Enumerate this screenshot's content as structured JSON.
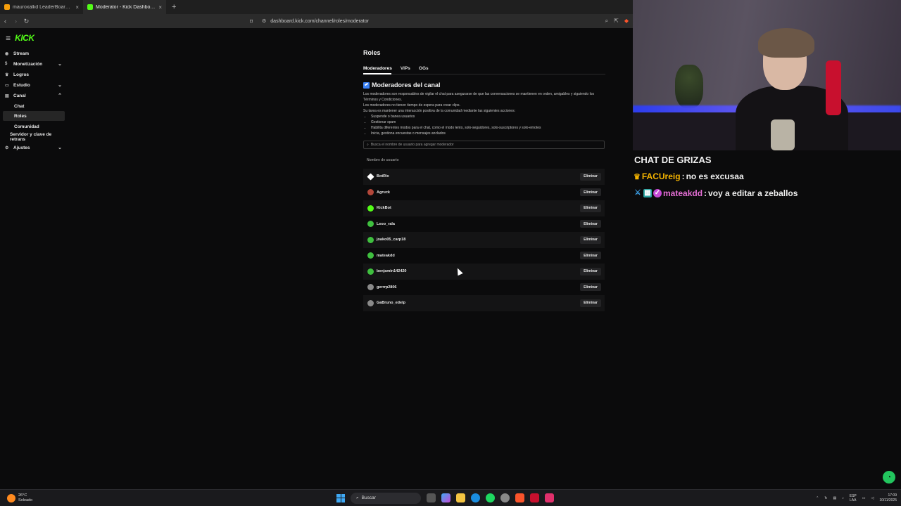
{
  "browser": {
    "tabs": [
      {
        "title": "mauroxalkd LeaderBoard | The best G",
        "active": false,
        "icon_color": "#f59e0b"
      },
      {
        "title": "Moderator - Kick Dashboard",
        "active": true,
        "icon_color": "#53fc18"
      }
    ],
    "close_glyph": "×",
    "new_tab_glyph": "+",
    "url": "dashboard.kick.com/channel/roles/moderator"
  },
  "sidebar": {
    "logo": "KICK",
    "items": [
      {
        "label": "Stream",
        "icon": "broadcast-icon",
        "chevron": ""
      },
      {
        "label": "Monetización",
        "icon": "money-icon",
        "chevron": "⌄"
      },
      {
        "label": "Logros",
        "icon": "trophy-icon",
        "chevron": ""
      },
      {
        "label": "Estudio",
        "icon": "studio-icon",
        "chevron": "⌄"
      },
      {
        "label": "Canal",
        "icon": "channel-icon",
        "chevron": "⌃"
      },
      {
        "label": "Chat",
        "icon": "",
        "chevron": ""
      },
      {
        "label": "Roles",
        "icon": "",
        "chevron": ""
      },
      {
        "label": "Comunidad",
        "icon": "",
        "chevron": ""
      },
      {
        "label": "Servidor y clave de retrans",
        "icon": "",
        "chevron": ""
      },
      {
        "label": "Ajustes",
        "icon": "gear-icon",
        "chevron": "⌄"
      }
    ]
  },
  "main": {
    "title": "Roles",
    "tabs": [
      "Moderadores",
      "VIPs",
      "OGs"
    ],
    "section_title": "Moderadores del canal",
    "desc1": "Los moderadores son responsables de vigilar el chat para asegurarse de que las conversaciones se mantienen en orden, amigables y siguiendo los Términos y Condiciones.",
    "desc2": "Los moderadores no tienen tiempo de espera para crear clips.",
    "desc3": "Su tarea es mantener una interacción positiva de la comunidad mediante las siguientes acciones:",
    "bullets": [
      "Suspende o banea usuarios",
      "Gestionar spam",
      "Habilita diferentes modos para el chat, como el modo lento, solo-seguidores, solo-suscriptores y solo-emotes",
      "Inicia, gestiona encuestas o mensajes anclados"
    ],
    "search_placeholder": "Busca el nombre de usuario para agregar moderador",
    "column_header": "Nombre de usuario",
    "remove_label": "Eliminar",
    "moderators": [
      {
        "name": "BotRix",
        "avatar": "#ffffff"
      },
      {
        "name": "Agruck",
        "avatar": "#b3473a"
      },
      {
        "name": "KickBot",
        "avatar": "#53fc18"
      },
      {
        "name": "Leoo_rala",
        "avatar": "#3fbf3f"
      },
      {
        "name": "joako05_carp18",
        "avatar": "#3fbf3f"
      },
      {
        "name": "mateakdd",
        "avatar": "#3fbf3f"
      },
      {
        "name": "benjamin142420",
        "avatar": "#3fbf3f"
      },
      {
        "name": "gerrrp2806",
        "avatar": "#8a8a8a"
      },
      {
        "name": "GaBruno_edelp",
        "avatar": "#8a8a8a"
      }
    ]
  },
  "stream_overlay": {
    "chat_title": "CHAT DE GRIZAS",
    "messages": [
      {
        "user": "FACUreig",
        "text": "no es excusaa",
        "user_color": "#f5b400"
      },
      {
        "user": "mateakdd",
        "text": "voy a editar a zeballos",
        "user_color": "#e56fd6"
      }
    ]
  },
  "taskbar": {
    "weather_temp": "26°C",
    "weather_desc": "Soleado",
    "search_label": "Buscar",
    "lang1": "ESP",
    "lang2": "LAA",
    "time": "17:09",
    "date": "10/11/2025"
  }
}
